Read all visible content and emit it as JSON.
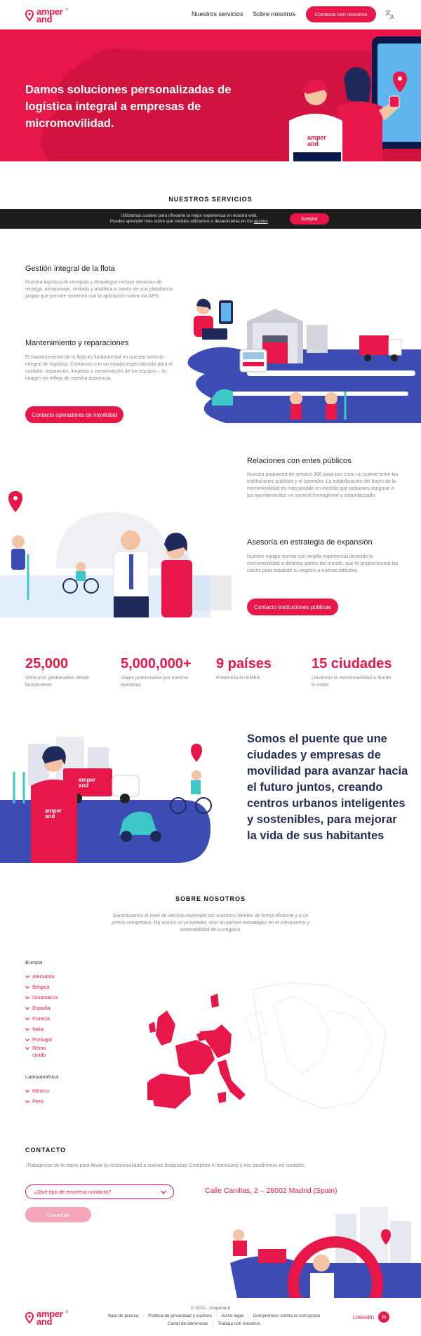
{
  "brand": {
    "logo_line1": "amper",
    "logo_line2": "and",
    "registered": "®",
    "accent": "#e8174a"
  },
  "nav": {
    "services": "Nuestros servicios",
    "about": "Sobre nosotros",
    "contact_cta": "Contacta con nosotros",
    "lang_icon": "translate-icon"
  },
  "hero": {
    "title": "Damos soluciones personalizadas de logística integral a empresas de micromovilidad.",
    "shirt_line1": "amper",
    "shirt_line2": "and"
  },
  "services": {
    "title": "NUESTROS SERVICIOS"
  },
  "cookie": {
    "text_line1": "Utilizamos cookies para ofrecerte la mejor experiencia en nuestra web.",
    "text_line2_pre": "Puedes aprender más sobre qué cookies utilizamos o desactivarlas en los ",
    "text_line2_link": "ajustes",
    "text_line2_post": ".",
    "accept": "Aceptar"
  },
  "block1": {
    "h1": "Gestión integral de la flota",
    "p1": "Nuestra logística de recogida y despliegue incluye servicios de recarga, almacenaje, vinilado y analítica a través de una plataforma propia que permite conexión con la aplicación nativa vía APIs.",
    "h2": "Mantenimiento y reparaciones",
    "p2": "El mantenimiento de tu flota es fundamental en nuestro servicio integral de logística. Contamos con un equipo especializado para el cuidado, reparación, limpieza y conservación de tus equipos – tu imagen es reflejo de nuestra asistencia.",
    "cta": "Contacto operadores de movilidad"
  },
  "block2": {
    "h1": "Relaciones con entes públicos",
    "p1": "Nuestra propuesta de servicio 360 pasa por crear un puente entre las instituciones públicas y el operador. La estabilización del boom de la micromovilidad es más posible en medida que podamos asegurar a los ayuntamientos un servicio homogéneo y estandarizado.",
    "h2": "Asesoría en estrategia de expansión",
    "p2": "Nuestro equipo cuenta con amplia experiencia llevando la micromovilidad a distintas partes del mundo, que te proporcionará las claves para expandir tu negocio a nuevas latitudes.",
    "cta": "Contacto instituciones públicas"
  },
  "stats": [
    {
      "num": "25,000",
      "label": "Vehículos gestionados desde lanzamiento"
    },
    {
      "num": "5,000,000+",
      "label": "Viajes potenciados por nuestra operativa"
    },
    {
      "num": "9 países",
      "label": "Presencia en EMEA"
    },
    {
      "num": "15 ciudades",
      "label": "Llevamos la micromovilidad a donde tú estés"
    }
  ],
  "mission": {
    "text": "Somos el puente que une ciudades y empresas de movilidad para avanzar hacia el futuro juntos, creando centros urbanos inteligentes y sostenibles, para mejorar la vida de sus habitantes",
    "truck_line1": "amper",
    "truck_line2": "and"
  },
  "about": {
    "title": "SOBRE NOSOTROS",
    "text": "Garantizamos el nivel de servicio esperado por nuestros clientes de forma eficiente y a un precio competitivo. No somos un proveedor, sino un partner estratégico en el crecimiento y sostenibilidad de tu negocio.",
    "europe_label": "Europa",
    "europe": [
      "Alemania",
      "Bélgica",
      "Dinamarca",
      "España",
      "Francia",
      "Italia",
      "Portugal",
      "Reino Unido"
    ],
    "latam_label": "Latinoamérica",
    "latam": [
      "México",
      "Perú"
    ]
  },
  "contact": {
    "title": "CONTACTO",
    "intro": "¡Trabajemos de la mano para llevar la micromovilidad a nuevas distancias! Completa el formulario y nos pondremos en contacto.",
    "select_placeholder": "¿Qué tipo de empresa contacta?",
    "address": "Calle Canillas, 2 – 28002 Madrid (Spain)",
    "submit": "Contactar"
  },
  "footer": {
    "copyright": "© 2021 - Amperand",
    "links_row1": [
      "Sala de prensa",
      "Política de privacidad y cookies",
      "Aviso legal",
      "Compromiso contra la corrupción"
    ],
    "links_row2": [
      "Canal de denuncias",
      "Trabaja con nosotros"
    ],
    "linkedin": "LinkedIn",
    "linkedin_icon": "in"
  }
}
